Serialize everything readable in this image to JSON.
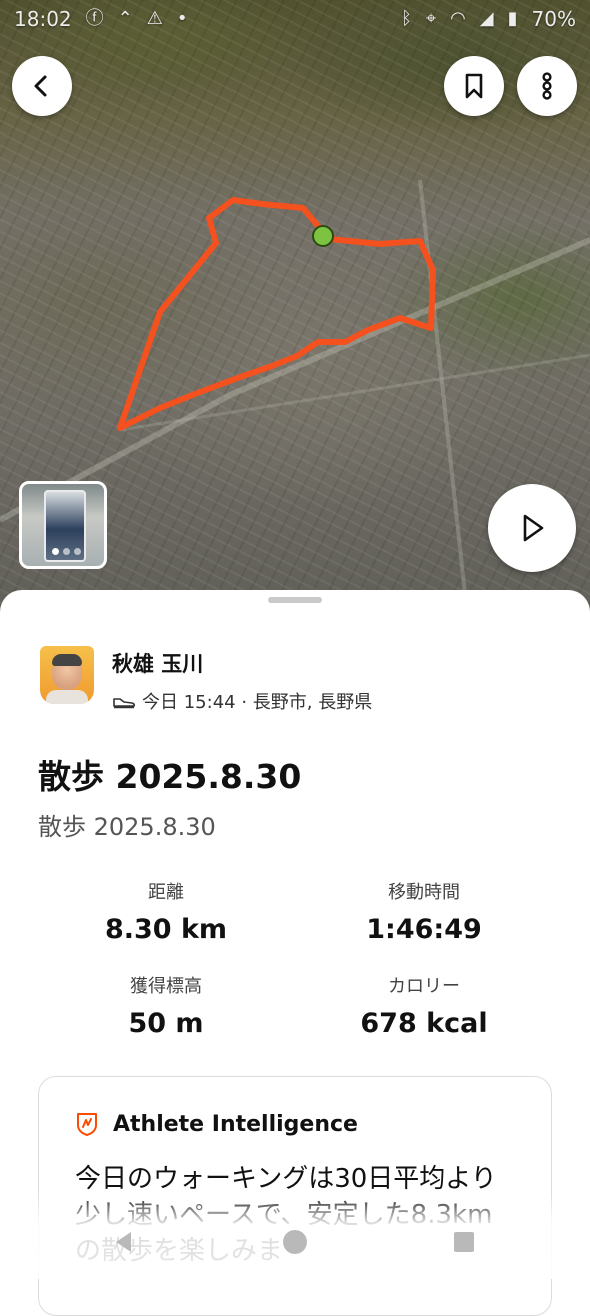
{
  "status_bar": {
    "time": "18:02",
    "battery": "70%",
    "left_icons": [
      "facebook-icon",
      "signal-arrow-icon",
      "warning-icon",
      "dot-icon"
    ],
    "right_icons": [
      "bluetooth-icon",
      "location-icon",
      "wifi-icon",
      "cell-signal-icon",
      "battery-icon"
    ]
  },
  "map": {
    "route_color": "#f4511e",
    "start_marker_color": "#7dc241"
  },
  "photo_thumbnail": {
    "count": 3,
    "active_index": 0
  },
  "athlete": {
    "name": "秋雄 玉川",
    "activity_icon": "shoe-icon",
    "meta": "今日 15:44 · 長野市, 長野県"
  },
  "activity": {
    "title": "散歩 2025.8.30",
    "description": "散歩 2025.8.30"
  },
  "stats": [
    {
      "label": "距離",
      "value": "8.30 km"
    },
    {
      "label": "移動時間",
      "value": "1:46:49"
    },
    {
      "label": "獲得標高",
      "value": "50 m"
    },
    {
      "label": "カロリー",
      "value": "678 kcal"
    }
  ],
  "athlete_intelligence": {
    "title": "Athlete Intelligence",
    "text": "今日のウォーキングは30日平均より少し速いペースで、安定した8.3kmの散歩を楽しみま",
    "accent_color": "#fc4c02"
  }
}
